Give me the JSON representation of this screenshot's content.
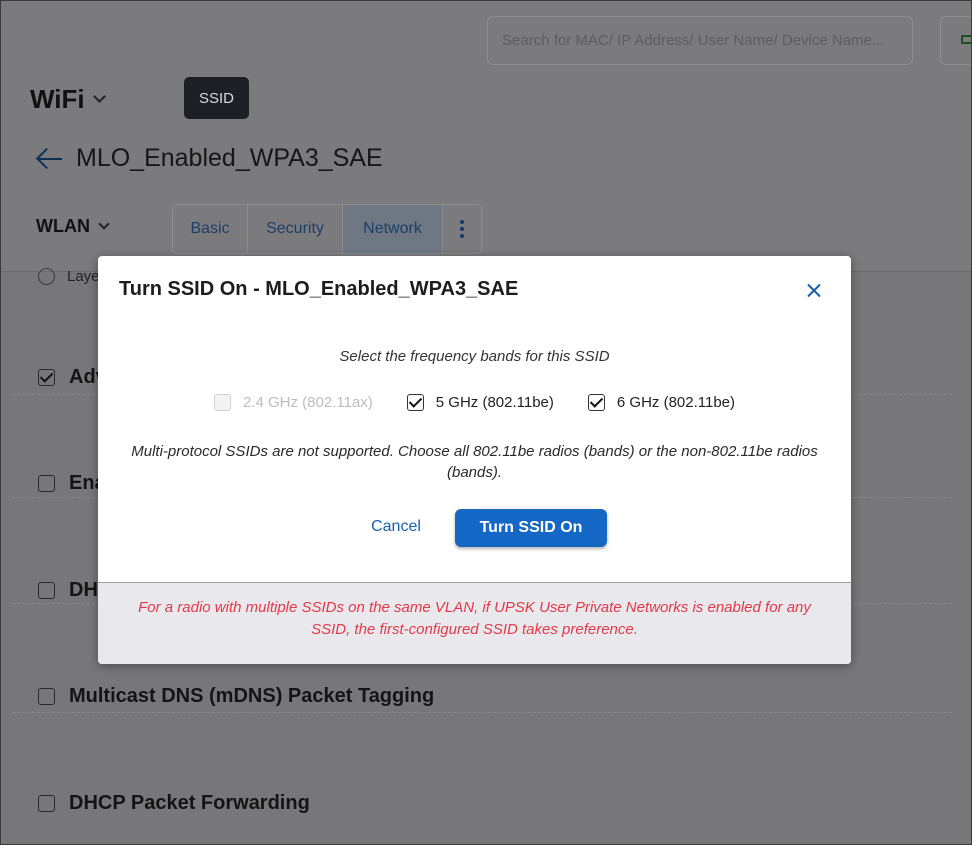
{
  "header": {
    "search_placeholder": "Search for MAC/ IP Address/ User Name/ Device Name...",
    "app_title": "WiFi",
    "ssid_tag": "SSID",
    "page_title": "MLO_Enabled_WPA3_SAE",
    "wlan_dropdown": "WLAN"
  },
  "tabs": [
    {
      "label": "Basic"
    },
    {
      "label": "Security"
    },
    {
      "label": "Network",
      "active": true
    }
  ],
  "background_items": {
    "layer": "Laye",
    "advanced": "Adv",
    "enable": "Ena",
    "dhcp": "DH",
    "mdns": "Multicast DNS (mDNS) Packet Tagging",
    "dhcp_forwarding": "DHCP Packet Forwarding"
  },
  "modal": {
    "title": "Turn SSID On - MLO_Enabled_WPA3_SAE",
    "prompt": "Select the frequency bands for this SSID",
    "bands": [
      {
        "label": "2.4 GHz (802.11ax)",
        "checked": false,
        "disabled": true
      },
      {
        "label": "5 GHz (802.11be)",
        "checked": true,
        "disabled": false
      },
      {
        "label": "6 GHz (802.11be)",
        "checked": true,
        "disabled": false
      }
    ],
    "note": "Multi-protocol SSIDs are not supported. Choose all 802.11be radios (bands) or the non-802.11be radios (bands).",
    "cancel_label": "Cancel",
    "confirm_label": "Turn SSID On",
    "warning": "For a radio with multiple SSIDs on the same VLAN, if UPSK User Private Networks is enabled for any SSID, the first-configured SSID takes preference."
  },
  "colors": {
    "primary_button": "#1467c4",
    "link": "#1a61ad",
    "warning_text": "#e23a4a",
    "overlay": "#777779"
  }
}
